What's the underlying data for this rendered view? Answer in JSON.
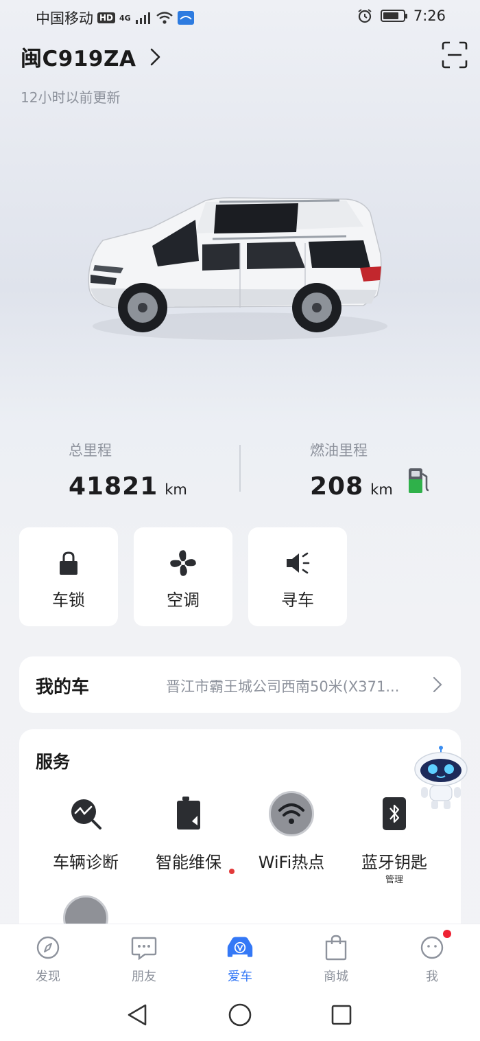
{
  "status_bar": {
    "carrier": "中国移动",
    "hd": "HD",
    "network": "4G",
    "time": "7:26"
  },
  "header": {
    "plate": "闽C919ZA",
    "update_text": "12小时以前更新"
  },
  "stats": {
    "total_mileage_label": "总里程",
    "total_mileage_value": "41821",
    "total_mileage_unit": "km",
    "fuel_range_label": "燃油里程",
    "fuel_range_value": "208",
    "fuel_range_unit": "km"
  },
  "quick_actions": [
    {
      "label": "车锁",
      "icon": "lock-icon"
    },
    {
      "label": "空调",
      "icon": "fan-icon"
    },
    {
      "label": "寻车",
      "icon": "speaker-icon"
    }
  ],
  "my_car": {
    "title": "我的车",
    "location": "晋江市霸王城公司西南50米(X371..."
  },
  "services": {
    "title": "服务",
    "items": [
      {
        "label": "车辆诊断",
        "sub": "",
        "icon": "diagnosis-icon"
      },
      {
        "label": "智能维保",
        "sub": "",
        "icon": "maintenance-icon"
      },
      {
        "label": "WiFi热点",
        "sub": "",
        "icon": "wifi-icon"
      },
      {
        "label": "蓝牙钥匙",
        "sub": "管理",
        "icon": "bluetooth-key-icon"
      }
    ]
  },
  "tabbar": {
    "items": [
      {
        "label": "发现",
        "icon": "compass-icon"
      },
      {
        "label": "朋友",
        "icon": "chat-icon"
      },
      {
        "label": "爱车",
        "icon": "car-icon"
      },
      {
        "label": "商城",
        "icon": "shopping-bag-icon"
      },
      {
        "label": "我",
        "icon": "profile-icon"
      }
    ],
    "active": "爱车"
  },
  "colors": {
    "accent": "#3478f6",
    "badge": "#ee2233",
    "fuel_green": "#2fb14a"
  }
}
